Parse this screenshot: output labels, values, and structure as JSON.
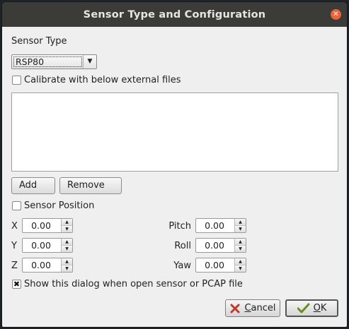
{
  "window": {
    "title": "Sensor Type and Configuration"
  },
  "sensor_type": {
    "label": "Sensor Type",
    "selected": "RSP80"
  },
  "calibrate": {
    "label": "Calibrate with below external files",
    "checked": false
  },
  "files": {
    "add_label": "Add",
    "remove_label": "Remove"
  },
  "sensor_position": {
    "label": "Sensor Position",
    "checked": false,
    "x": {
      "label": "X",
      "value": "0.00"
    },
    "y": {
      "label": "Y",
      "value": "0.00"
    },
    "z": {
      "label": "Z",
      "value": "0.00"
    },
    "pitch": {
      "label": "Pitch",
      "value": "0.00"
    },
    "roll": {
      "label": "Roll",
      "value": "0.00"
    },
    "yaw": {
      "label": "Yaw",
      "value": "0.00"
    }
  },
  "show_dialog": {
    "label": "Show this dialog when open sensor or PCAP file",
    "checked": true
  },
  "actions": {
    "cancel_mnemonic": "C",
    "cancel_rest": "ancel",
    "ok_mnemonic": "O",
    "ok_rest": "K"
  },
  "colors": {
    "titlebar": "#3b3b38",
    "close": "#e9643a",
    "cancel_icon": "#c0392b",
    "ok_icon": "#6b8e23"
  }
}
